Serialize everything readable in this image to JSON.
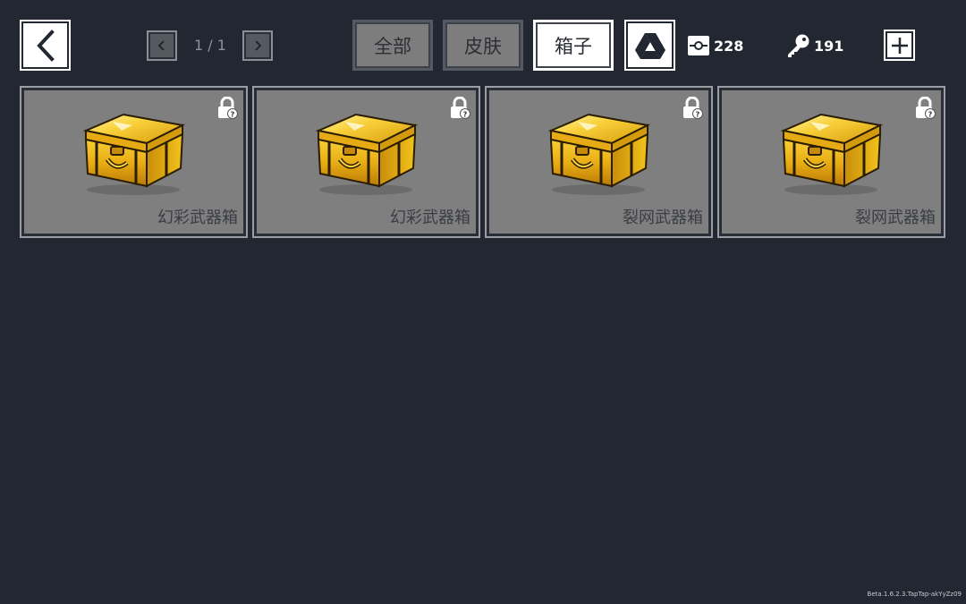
{
  "header": {
    "back_icon": "chevron-left-icon",
    "pager": {
      "prev_icon": "chevron-left-icon",
      "next_icon": "chevron-right-icon",
      "text": "1 / 1"
    },
    "tabs": [
      {
        "label": "全部",
        "active": false
      },
      {
        "label": "皮肤",
        "active": false
      },
      {
        "label": "箱子",
        "active": true
      }
    ],
    "drive_icon": "triangle-drive-icon",
    "currencies": [
      {
        "icon": "parts-icon",
        "value": "228"
      },
      {
        "icon": "key-icon",
        "value": "191"
      }
    ],
    "add_icon": "plus-icon"
  },
  "items": [
    {
      "name": "幻彩武器箱",
      "icon": "golden-chest-icon",
      "lock_icon": "lock-unknown-icon"
    },
    {
      "name": "幻彩武器箱",
      "icon": "golden-chest-icon",
      "lock_icon": "lock-unknown-icon"
    },
    {
      "name": "裂网武器箱",
      "icon": "golden-chest-icon",
      "lock_icon": "lock-unknown-icon"
    },
    {
      "name": "裂网武器箱",
      "icon": "golden-chest-icon",
      "lock_icon": "lock-unknown-icon"
    }
  ],
  "footer": {
    "version": "Beta.1.6.2.3.TapTap-akYyZz09"
  },
  "colors": {
    "background": "#222731",
    "card": "#7f7f7f",
    "tab_inactive": "#7d7d7d",
    "tab_active": "#ffffff",
    "chest_gold": "#f2c21b"
  }
}
